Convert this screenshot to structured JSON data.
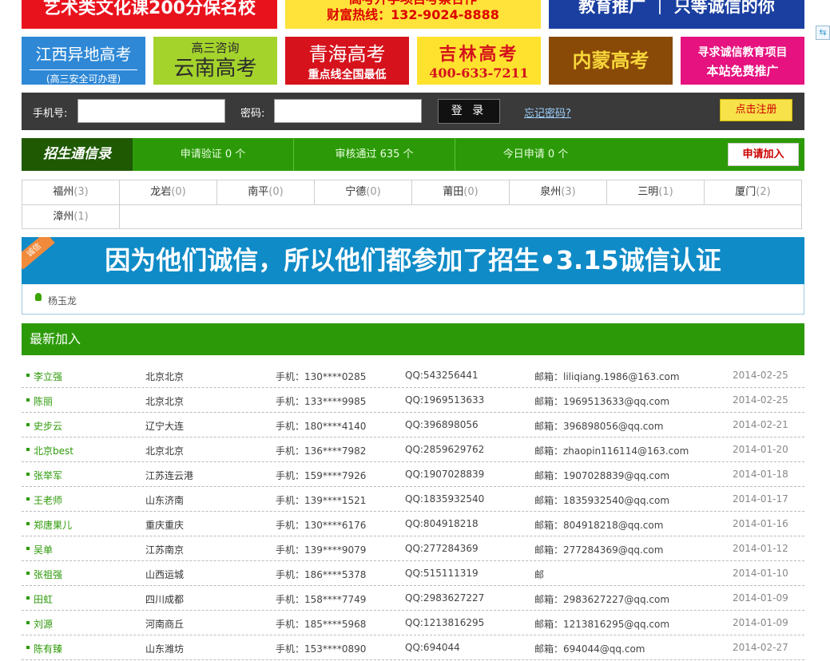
{
  "banners_top": [
    {
      "line1": "艺术类文化课200分保名校"
    },
    {
      "line1": "高考升学项目考察合作",
      "line2": "财富热线：132-9024-8888"
    },
    {
      "line1": "教育推广 ｜ 只等诚信的你"
    }
  ],
  "banners_row2": [
    {
      "line1": "江西异地高考",
      "line2": "(高三安全可办理)"
    },
    {
      "line1": "高三咨询",
      "line2": "云南高考"
    },
    {
      "line1": "青海高考",
      "line2": "重点线全国最低"
    },
    {
      "line1": "吉林高考",
      "line2": "400-633-7211"
    },
    {
      "line1": "内蒙高考"
    },
    {
      "line1": "寻求诚信教育项目",
      "line2": "本站免费推广"
    }
  ],
  "login": {
    "phone_label": "手机号:",
    "password_label": "密码:",
    "login_button": "登 录",
    "forgot_link": "忘记密码?",
    "register_button": "点击注册"
  },
  "stats": {
    "title": "招生通信录",
    "apply_verify": "申请验证 0 个",
    "approved": "审核通过 635 个",
    "today": "今日申请 0 个",
    "apply_button": "申请加入"
  },
  "cities": [
    {
      "name": "福州",
      "count": "(3)"
    },
    {
      "name": "龙岩",
      "count": "(0)"
    },
    {
      "name": "南平",
      "count": "(0)"
    },
    {
      "name": "宁德",
      "count": "(0)"
    },
    {
      "name": "莆田",
      "count": "(0)"
    },
    {
      "name": "泉州",
      "count": "(3)"
    },
    {
      "name": "三明",
      "count": "(1)"
    },
    {
      "name": "厦门",
      "count": "(2)"
    },
    {
      "name": "漳州",
      "count": "(1)"
    }
  ],
  "integrity": {
    "ribbon": "诚信",
    "headline": "因为他们诚信，所以他们都参加了招生•3.15诚信认证",
    "member": "杨玉龙"
  },
  "latest": {
    "title": "最新加入",
    "members": [
      {
        "name": "李立强",
        "city": "北京北京",
        "phone": "手机：130****0285",
        "qq": "QQ:543256441",
        "email": "邮箱：liliqiang.1986@163.com",
        "date": "2014-02-25"
      },
      {
        "name": "陈丽",
        "city": "北京北京",
        "phone": "手机：133****9985",
        "qq": "QQ:1969513633",
        "email": "邮箱：1969513633@qq.com",
        "date": "2014-02-25"
      },
      {
        "name": "史步云",
        "city": "辽宁大连",
        "phone": "手机：180****4140",
        "qq": "QQ:396898056",
        "email": "邮箱：396898056@qq.com",
        "date": "2014-02-21"
      },
      {
        "name": "北京best",
        "city": "北京北京",
        "phone": "手机：136****7982",
        "qq": "QQ:2859629762",
        "email": "邮箱：zhaopin116114@163.com",
        "date": "2014-01-20"
      },
      {
        "name": "张举军",
        "city": "江苏连云港",
        "phone": "手机：159****7926",
        "qq": "QQ:1907028839",
        "email": "邮箱：1907028839@qq.com",
        "date": "2014-01-18"
      },
      {
        "name": "王老师",
        "city": "山东济南",
        "phone": "手机：139****1521",
        "qq": "QQ:1835932540",
        "email": "邮箱：1835932540@qq.com",
        "date": "2014-01-17"
      },
      {
        "name": "郑唐果儿",
        "city": "重庆重庆",
        "phone": "手机：130****6176",
        "qq": "QQ:804918218",
        "email": "邮箱：804918218@qq.com",
        "date": "2014-01-16"
      },
      {
        "name": "吴单",
        "city": "江苏南京",
        "phone": "手机：139****9079",
        "qq": "QQ:277284369",
        "email": "邮箱：277284369@qq.com",
        "date": "2014-01-12"
      },
      {
        "name": "张祖强",
        "city": "山西运城",
        "phone": "手机：186****5378",
        "qq": "QQ:515111319",
        "email": "邮",
        "date": "2014-01-10"
      },
      {
        "name": "田虹",
        "city": "四川成都",
        "phone": "手机：158****7749",
        "qq": "QQ:2983627227",
        "email": "邮箱：2983627227@qq.com",
        "date": "2014-01-09"
      },
      {
        "name": "刘源",
        "city": "河南商丘",
        "phone": "手机：185****5968",
        "qq": "QQ:1213816295",
        "email": "邮箱：1213816295@qq.com",
        "date": "2014-01-09"
      },
      {
        "name": "陈有臻",
        "city": "山东潍坊",
        "phone": "手机：153****0890",
        "qq": "QQ:694044",
        "email": "邮箱：694044@qq.com",
        "date": "2014-02-27"
      }
    ]
  }
}
